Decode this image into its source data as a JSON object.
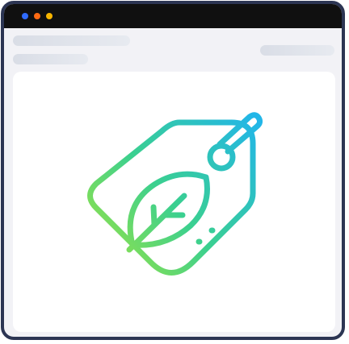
{
  "window": {
    "controls": [
      {
        "name": "close-dot-icon",
        "color": "#2f6bff"
      },
      {
        "name": "minimize-dot-icon",
        "color": "#ff6a13"
      },
      {
        "name": "maximize-dot-icon",
        "color": "#f7b500"
      }
    ],
    "border_color": "#2c3553",
    "titlebar_color": "#101010"
  },
  "illustration": {
    "icon": "eco-price-tag-icon",
    "leaf_icon": "leaf-icon",
    "gradient": [
      "#a8e63a",
      "#3bd08f",
      "#22b6e8"
    ]
  }
}
